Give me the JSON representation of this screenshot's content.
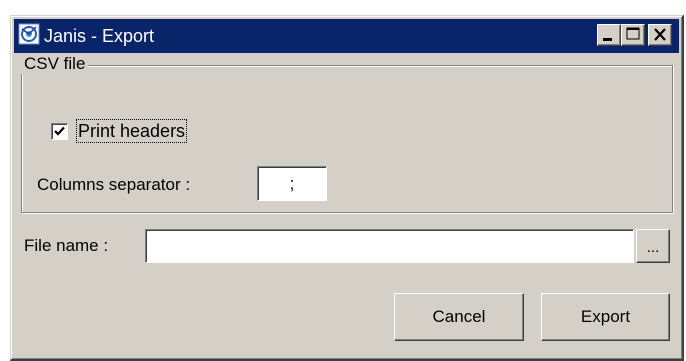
{
  "window": {
    "title": "Janis - Export",
    "app_icon": "janis-app-icon",
    "controls": {
      "minimize_icon": "minimize-icon",
      "maximize_icon": "maximize-icon",
      "close_icon": "close-icon"
    }
  },
  "csv_group": {
    "legend": "CSV file",
    "print_headers": {
      "label": "Print headers",
      "checked": true
    },
    "separator": {
      "label": "Columns separator :",
      "value": ";"
    }
  },
  "file": {
    "label": "File name :",
    "value": "",
    "browse_label": "..."
  },
  "actions": {
    "cancel_label": "Cancel",
    "export_label": "Export"
  },
  "colors": {
    "titlebar": "#0a246a",
    "face": "#d4d0c8",
    "field": "#ffffff"
  }
}
